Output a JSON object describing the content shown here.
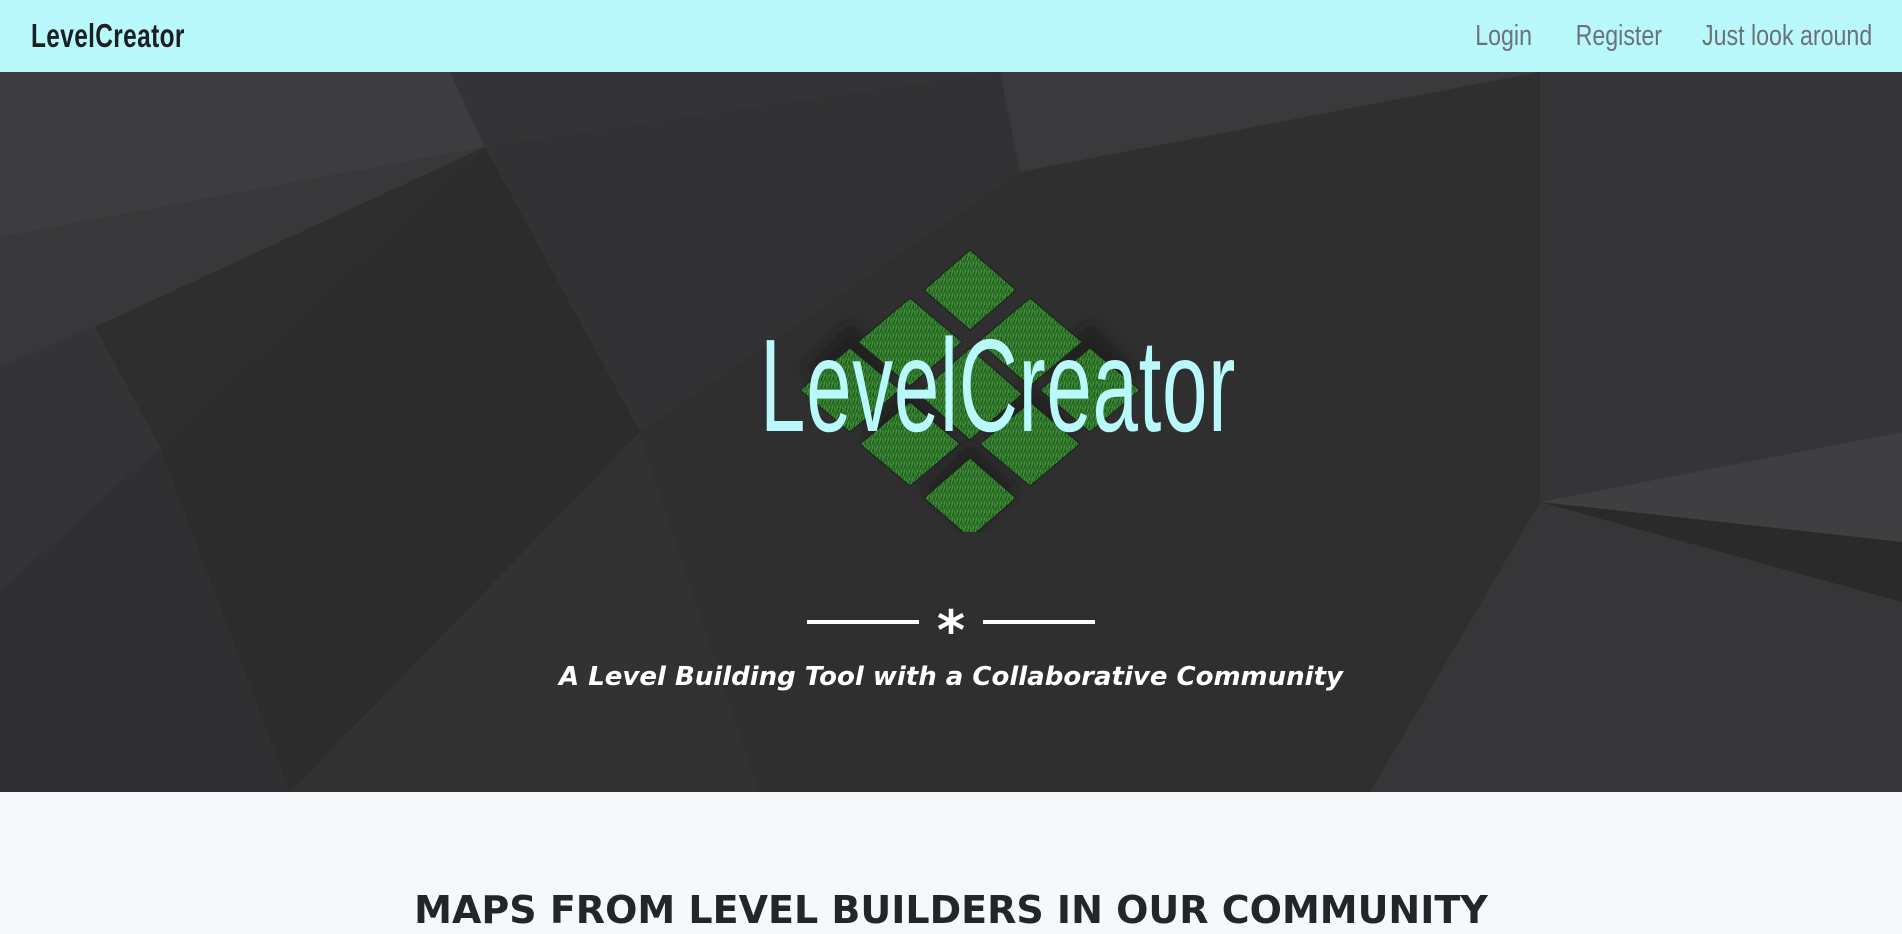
{
  "navbar": {
    "brand": "LevelCreator",
    "links": [
      "Login",
      "Register",
      "Just look around"
    ]
  },
  "hero": {
    "logo_text": "LevelCreator",
    "divider_symbol": "*",
    "tagline": "A Level Building Tool with a Collaborative Community"
  },
  "section": {
    "title": "MAPS FROM LEVEL BUILDERS IN OUR COMMUNITY"
  },
  "colors": {
    "navbar_bg": "#b9f9fb",
    "hero_bg": "#2e2e2f",
    "logo_text": "#b9f9fb",
    "grass": "#2f7a2f",
    "page_bg": "#f7f8fa"
  },
  "icons": [
    "grass-tile-logo-icon",
    "asterisk-icon"
  ]
}
